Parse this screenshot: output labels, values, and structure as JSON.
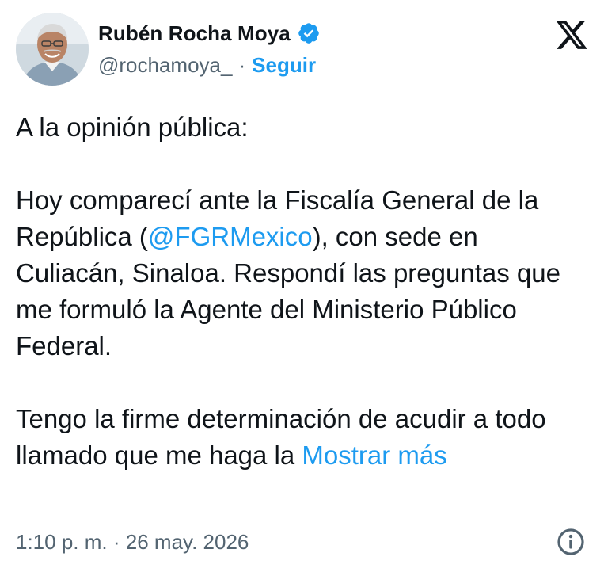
{
  "author": {
    "name": "Rubén Rocha Moya",
    "handle": "@rochamoya_",
    "separator": "·",
    "follow_label": "Seguir",
    "verified_icon": "verified-badge-icon"
  },
  "brand": {
    "logo": "x-logo-icon"
  },
  "tweet": {
    "line1": "A la opinión pública:",
    "para2_pre": "Hoy comparecí ante la Fiscalía General de la República (",
    "mention": "@FGRMexico",
    "para2_post": "), con sede en Culiacán, Sinaloa. Respondí las preguntas que me formuló la Agente del Ministerio Público Federal.",
    "para3": "Tengo la firme determinación de acudir a todo llamado que me haga la ",
    "show_more": "Mostrar más"
  },
  "footer": {
    "time": "1:10 p. m.",
    "separator": "·",
    "date": "26 may. 2026",
    "info_icon": "info-icon"
  },
  "colors": {
    "accent": "#1d9bf0",
    "text": "#0f1419",
    "muted": "#536471"
  }
}
